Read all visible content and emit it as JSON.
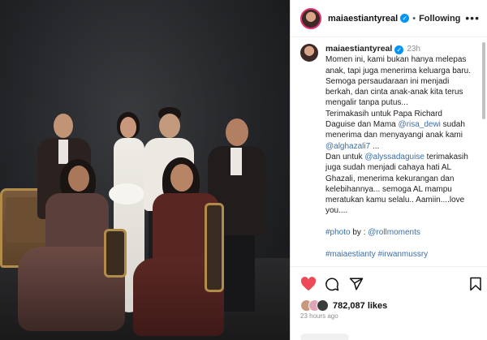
{
  "post": {
    "username": "maiaestiantyreal",
    "follow_label": "Following",
    "separator": "•",
    "more_label": "•••",
    "time_ago_short": "23h",
    "caption_lines": [
      "Momen ini, kami bukan hanya melepas",
      "anak, tapi juga menerima keluarga baru.",
      "Semoga persaudaraan ini menjadi",
      "berkah, dan cinta anak-anak kita terus",
      "mengalir tanpa putus...",
      "Terimakasih untuk Papa Richard",
      "Daguise dan Mama ",
      "@risa_dewi",
      " sudah",
      "menerima dan menyayangi anak kami",
      "@alghazali7",
      " ...",
      "Dan untuk ",
      "@alyssadaguise",
      " terimakasih",
      "juga sudah menjadi cahaya hati AL",
      "Ghazali, menerima kekurangan dan",
      "kelebihannya... semoga AL mampu",
      "meratukan kamu selalu.. Aamiin....love",
      "you....",
      "#photo",
      " by : ",
      "@rollmoments",
      "#maiaestianty #irwanmussry"
    ],
    "likes": "782,087 likes",
    "time_ago_long": "23 hours ago"
  },
  "icons": {
    "verified": "verified-badge",
    "like": "heart-icon",
    "comment": "comment-icon",
    "share": "send-icon",
    "save": "bookmark-icon"
  },
  "colors": {
    "heart": "#ed4956",
    "link": "#3a6ea5",
    "verified": "#0095f6"
  }
}
